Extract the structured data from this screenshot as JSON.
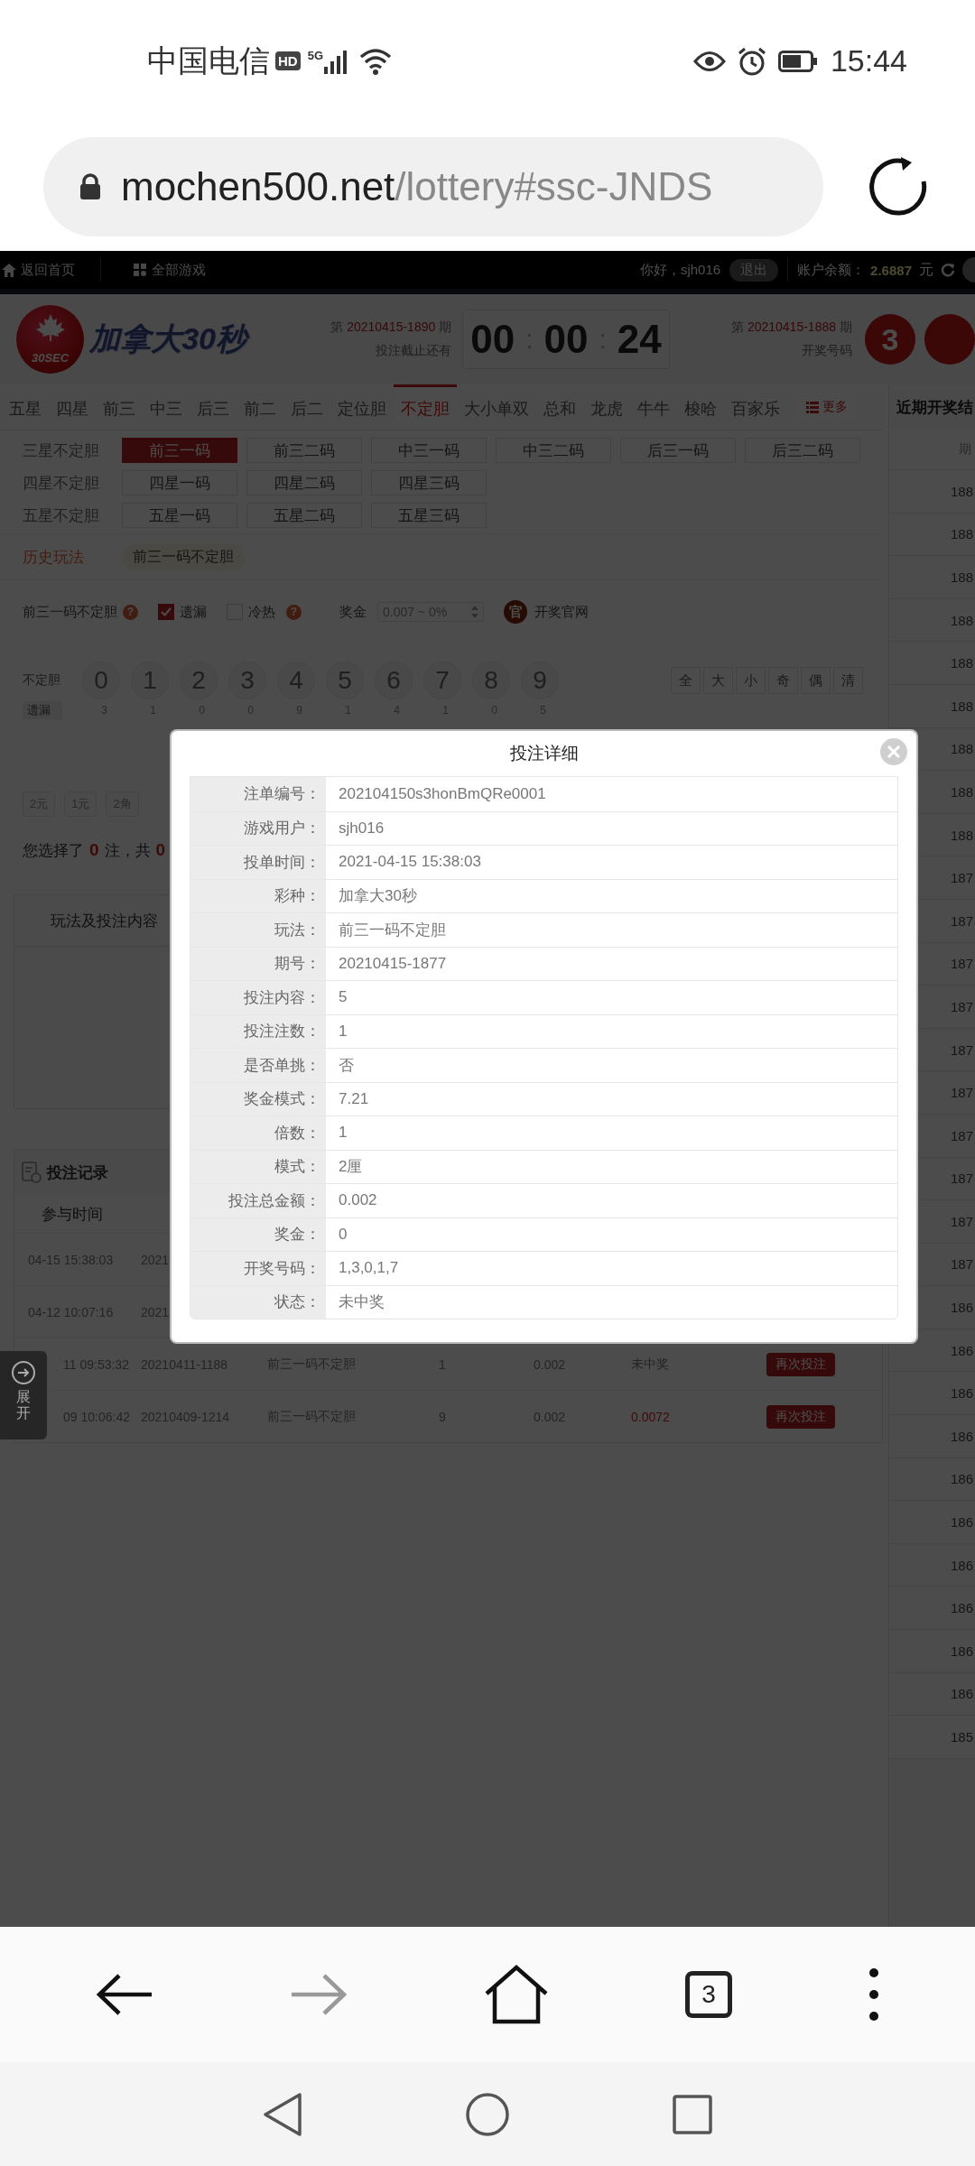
{
  "status_bar": {
    "carrier": "中国电信",
    "hd_badge": "HD",
    "network": "5G",
    "time": "15:44"
  },
  "address_bar": {
    "domain": "mochen500.net",
    "path": "/lottery#ssc-JNDS"
  },
  "top_nav": {
    "home": "返回首页",
    "all_games": "全部游戏",
    "greeting": "你好，sjh016",
    "logout": "退出",
    "balance_label": "账户余额：",
    "balance": "2.6887",
    "currency": "元"
  },
  "header": {
    "logo_badge": "30SEC",
    "game_title": "加拿大30秒",
    "current_issue": {
      "prefix": "第",
      "issue": "20210415-1890",
      "suffix": "期",
      "caption": "投注截止还有"
    },
    "countdown": [
      "00",
      ":",
      "00",
      ":",
      "24"
    ],
    "last_issue": {
      "prefix": "第",
      "issue": "20210415-1888",
      "suffix": "期",
      "caption": "开奖号码"
    },
    "last_numbers": [
      "3"
    ]
  },
  "play_tabs": [
    {
      "label": "五星",
      "selected": false
    },
    {
      "label": "四星",
      "selected": false
    },
    {
      "label": "前三",
      "selected": false
    },
    {
      "label": "中三",
      "selected": false
    },
    {
      "label": "后三",
      "selected": false
    },
    {
      "label": "前二",
      "selected": false
    },
    {
      "label": "后二",
      "selected": false
    },
    {
      "label": "定位胆",
      "selected": false
    },
    {
      "label": "不定胆",
      "selected": true
    },
    {
      "label": "大小单双",
      "selected": false
    },
    {
      "label": "总和",
      "selected": false
    },
    {
      "label": "龙虎",
      "selected": false
    },
    {
      "label": "牛牛",
      "selected": false
    },
    {
      "label": "梭哈",
      "selected": false
    },
    {
      "label": "百家乐",
      "selected": false
    }
  ],
  "more_button": "更多",
  "recent_draws": {
    "title": "近期开奖结",
    "column": "期",
    "rows": [
      "188",
      "188",
      "188",
      "188",
      "188",
      "188",
      "188",
      "188",
      "188",
      "187",
      "187",
      "187",
      "187",
      "187",
      "187",
      "187",
      "187",
      "187",
      "187",
      "186",
      "186",
      "186",
      "186",
      "186",
      "186",
      "186",
      "186",
      "186",
      "186",
      "185"
    ]
  },
  "sub_groups": [
    {
      "label": "三星不定胆",
      "options": [
        {
          "label": "前三一码",
          "selected": true
        },
        {
          "label": "前三二码",
          "selected": false
        },
        {
          "label": "中三一码",
          "selected": false
        },
        {
          "label": "中三二码",
          "selected": false
        },
        {
          "label": "后三一码",
          "selected": false
        },
        {
          "label": "后三二码",
          "selected": false
        }
      ]
    },
    {
      "label": "四星不定胆",
      "options": [
        {
          "label": "四星一码",
          "selected": false
        },
        {
          "label": "四星二码",
          "selected": false
        },
        {
          "label": "四星三码",
          "selected": false
        }
      ]
    },
    {
      "label": "五星不定胆",
      "options": [
        {
          "label": "五星一码",
          "selected": false
        },
        {
          "label": "五星二码",
          "selected": false
        },
        {
          "label": "五星三码",
          "selected": false
        }
      ]
    }
  ],
  "history": {
    "label": "历史玩法",
    "items": [
      "前三一码不定胆"
    ]
  },
  "options_row": {
    "play_name": "前三一码不定胆",
    "play_help": "?",
    "toggles": [
      {
        "label": "遗漏",
        "checked": true
      },
      {
        "label": "冷热",
        "checked": false,
        "help": "?"
      }
    ],
    "prize_label": "奖金",
    "prize_select": "0.007 ~ 0%",
    "official_badge": "官",
    "official_link": "开奖官网"
  },
  "number_picker": {
    "label": "不定胆",
    "balls": [
      "0",
      "1",
      "2",
      "3",
      "4",
      "5",
      "6",
      "7",
      "8",
      "9"
    ],
    "quick": [
      "全",
      "大",
      "小",
      "奇",
      "偶",
      "清"
    ],
    "missing_label": "遗漏",
    "missing": [
      "3",
      "1",
      "0",
      "0",
      "9",
      "1",
      "4",
      "1",
      "0",
      "5"
    ]
  },
  "units": [
    "2元",
    "1元",
    "2角"
  ],
  "selection_summary": {
    "prefix": "您选择了",
    "count": "0",
    "middle": "注，共",
    "total": "0"
  },
  "bet_panel": {
    "header": "玩法及投注内容"
  },
  "bet_records": {
    "title": "投注记录",
    "column": "参与时间",
    "rows": [
      {
        "time": "04-15 15:38:03",
        "issue": "2021"
      },
      {
        "time": "04-12 10:07:16",
        "issue": "2021"
      },
      {
        "time": "11 09:53:32",
        "issue": "20210411-1188",
        "play": "前三一码不定胆",
        "count": "1",
        "amount": "0.002",
        "result": "未中奖",
        "won": false,
        "action": "再次投注"
      },
      {
        "time": "09 10:06:42",
        "issue": "20210409-1214",
        "play": "前三一码不定胆",
        "count": "9",
        "amount": "0.002",
        "result": "0.0072",
        "won": true,
        "action": "再次投注"
      }
    ]
  },
  "expand_tab": "展开",
  "modal": {
    "title": "投注详细",
    "rows": [
      {
        "label": "注单编号：",
        "value": "202104150s3honBmQRe0001"
      },
      {
        "label": "游戏用户：",
        "value": "sjh016"
      },
      {
        "label": "投单时间：",
        "value": "2021-04-15 15:38:03"
      },
      {
        "label": "彩种：",
        "value": "加拿大30秒"
      },
      {
        "label": "玩法：",
        "value": "前三一码不定胆"
      },
      {
        "label": "期号：",
        "value": "20210415-1877"
      },
      {
        "label": "投注内容：",
        "value": "5"
      },
      {
        "label": "投注注数：",
        "value": "1"
      },
      {
        "label": "是否单挑：",
        "value": "否"
      },
      {
        "label": "奖金模式：",
        "value": "7.21"
      },
      {
        "label": "倍数：",
        "value": "1"
      },
      {
        "label": "模式：",
        "value": "2厘"
      },
      {
        "label": "投注总金额：",
        "value": "0.002"
      },
      {
        "label": "奖金：",
        "value": "0"
      },
      {
        "label": "开奖号码：",
        "value": "1,3,0,1,7"
      },
      {
        "label": "状态：",
        "value": "未中奖"
      }
    ]
  },
  "browser_bar": {
    "tab_count": "3"
  }
}
